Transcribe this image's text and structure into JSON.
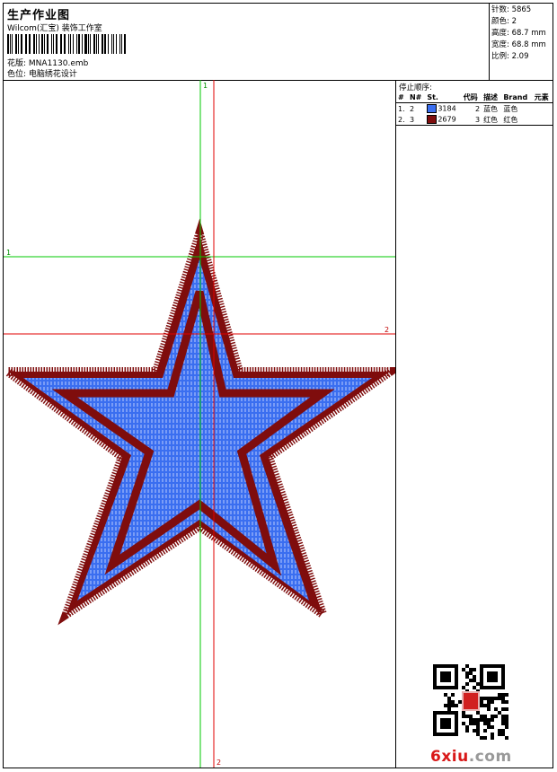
{
  "header": {
    "title": "生产作业图",
    "company": "Wilcom(汇宝) 装饰工作室",
    "design_label": "花版:",
    "design_value": "MNA1130.emb",
    "color_label": "色位:",
    "color_value": "电脑绣花设计"
  },
  "stats": {
    "stitches": "针数: 5865",
    "colors": "颜色: 2",
    "height": "高度: 68.7 mm",
    "width": "宽度: 68.8 mm",
    "scale": "比例: 2.09"
  },
  "stop_sequence": {
    "title": "停止顺序:",
    "columns": [
      "#",
      "N#",
      "St.",
      "代码",
      "描述",
      "Brand",
      "元素"
    ],
    "rows": [
      {
        "num": "1.",
        "n": "2",
        "color": "#3a6ef0",
        "stitches": "3184",
        "code": "2",
        "desc": "蓝色",
        "brand": "蓝色",
        "element": ""
      },
      {
        "num": "2.",
        "n": "3",
        "color": "#7f0d0d",
        "stitches": "2679",
        "code": "3",
        "desc": "红色",
        "brand": "红色",
        "element": ""
      }
    ]
  },
  "guides": {
    "h1": "1",
    "h2": "2",
    "v1": "1",
    "v2": "2",
    "green": "#00c800",
    "red": "#e00000"
  },
  "colors": {
    "blue": "#3a6ef0",
    "red": "#7f0d0d",
    "stitch_light": "#c8d6ff"
  },
  "watermark": {
    "brand": "6xiu",
    "domain": ".com"
  }
}
